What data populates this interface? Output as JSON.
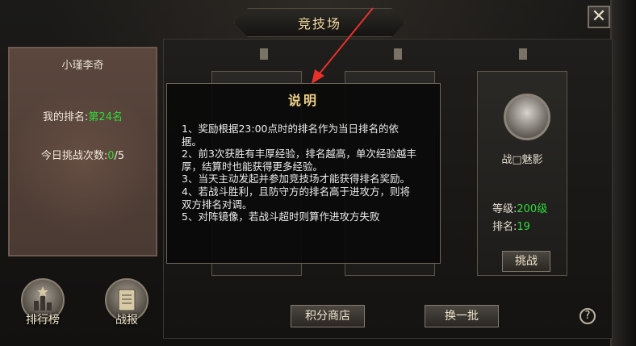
{
  "window": {
    "title": "竞技场",
    "close_symbol": "✕"
  },
  "player": {
    "name": "小瑾李奇",
    "rank_label": "我的排名:",
    "rank_value": "第24名",
    "challenges_label": "今日挑战次数:",
    "challenges_used": "0",
    "challenges_total": "/5"
  },
  "side_buttons": [
    {
      "label": "排行榜",
      "icon": "leaderboard-icon"
    },
    {
      "label": "战报",
      "icon": "scroll-icon"
    }
  ],
  "opponent": {
    "name": "战□魅影",
    "level_label": "等级:",
    "level_value": "200级",
    "rank_label": "排名:",
    "rank_value": "19",
    "challenge_label": "挑战"
  },
  "bottom_buttons": {
    "shop": "积分商店",
    "refresh": "换一批"
  },
  "help_symbol": "?",
  "rules_modal": {
    "title": "说明",
    "lines": [
      "1、奖励根据23:00点时的排名作为当日排名的依",
      "据。",
      "2、前3次获胜有丰厚经验，排名越高，单次经验越丰",
      "厚，结算时也能获得更多经验。",
      "3、当天主动发起并参加竞技场才能获得排名奖励。",
      "4、若战斗胜利，且防守方的排名高于进攻方，则将",
      "双方排名对调。",
      "5、对阵镜像，若战斗超时则算作进攻方失败"
    ]
  },
  "colors": {
    "highlight_green": "#2fdc3a",
    "title_gold": "#f1d38a",
    "annotation_red": "#e8312a"
  }
}
